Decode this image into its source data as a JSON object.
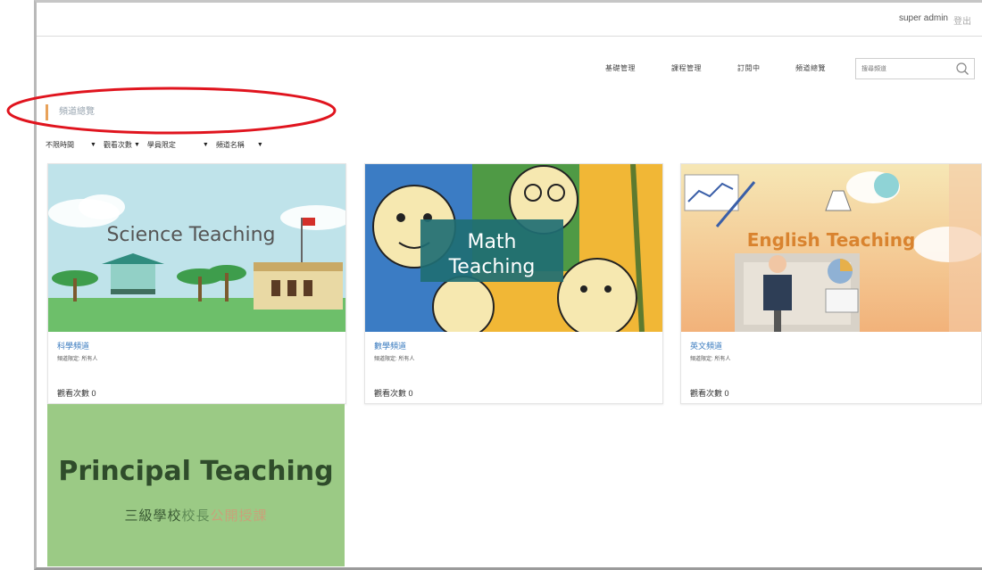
{
  "header": {
    "user": "super admin",
    "logout": "登出"
  },
  "nav": {
    "items": [
      {
        "label": "基礎管理"
      },
      {
        "label": "課程管理"
      },
      {
        "label": "訂閱中"
      },
      {
        "label": "頻道總覽"
      }
    ],
    "search_placeholder": "搜尋頻道",
    "icon": "search-icon"
  },
  "page": {
    "section_title": "頻道總覽"
  },
  "filters": [
    {
      "label": "不限時間"
    },
    {
      "label": "觀看次數"
    },
    {
      "label": "學員限定"
    },
    {
      "label": "頻道名稱"
    }
  ],
  "cards": [
    {
      "banner": "Science Teaching",
      "name": "科學頻道",
      "limit": "頻道限定: 所有人",
      "views_label": "觀看次數",
      "views": "0"
    },
    {
      "banner_line1": "Math",
      "banner_line2": "Teaching",
      "name": "數學頻道",
      "limit": "頻道限定: 所有人",
      "views_label": "觀看次數",
      "views": "0"
    },
    {
      "banner": "English Teaching",
      "name": "英文頻道",
      "limit": "頻道限定: 所有人",
      "views_label": "觀看次數",
      "views": "0"
    }
  ],
  "principal_card": {
    "title": "Principal Teaching",
    "sub_part1": "三級學校",
    "sub_part2": "校長",
    "sub_part3": "公開授課"
  },
  "colors": {
    "accent": "#e8a25a",
    "link": "#3a7bbf",
    "annotation": "#e0141e",
    "principal_bg": "#9bca85"
  }
}
